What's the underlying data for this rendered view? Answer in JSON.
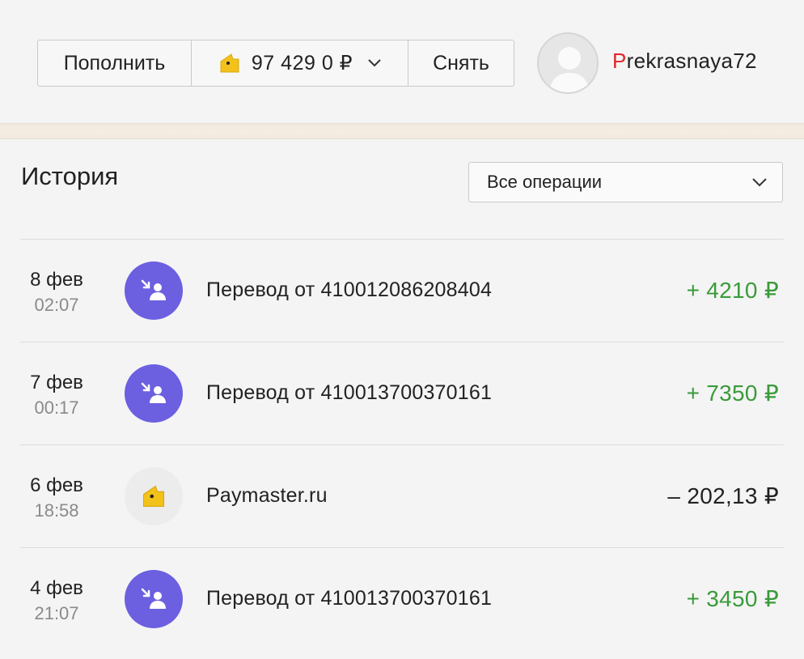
{
  "header": {
    "topup_label": "Пополнить",
    "balance": "97 429 0 ₽",
    "withdraw_label": "Снять",
    "username_first": "P",
    "username_rest": "rekrasnaya72"
  },
  "history": {
    "title": "История",
    "filter_value": "Все операции",
    "operations": [
      {
        "day": "8 фев",
        "time": "02:07",
        "type": "transfer",
        "icon": "incoming-transfer-icon",
        "description": "Перевод от 410012086208404",
        "amount": "+ 4210 ₽",
        "direction": "income"
      },
      {
        "day": "7 фев",
        "time": "00:17",
        "type": "transfer",
        "icon": "incoming-transfer-icon",
        "description": "Перевод от 410013700370161",
        "amount": "+ 7350 ₽",
        "direction": "income"
      },
      {
        "day": "6 фев",
        "time": "18:58",
        "type": "shop",
        "icon": "wallet-icon",
        "description": "Paymaster.ru",
        "amount": "– 202,13 ₽",
        "direction": "expense"
      },
      {
        "day": "4 фев",
        "time": "21:07",
        "type": "transfer",
        "icon": "incoming-transfer-icon",
        "description": "Перевод от 410013700370161",
        "amount": "+ 3450 ₽",
        "direction": "income"
      }
    ]
  },
  "colors": {
    "income": "#3a9a3a",
    "transfer_icon_bg": "#6c5fe0",
    "wallet_yellow": "#f2c21b",
    "username_accent": "#e0252a"
  }
}
